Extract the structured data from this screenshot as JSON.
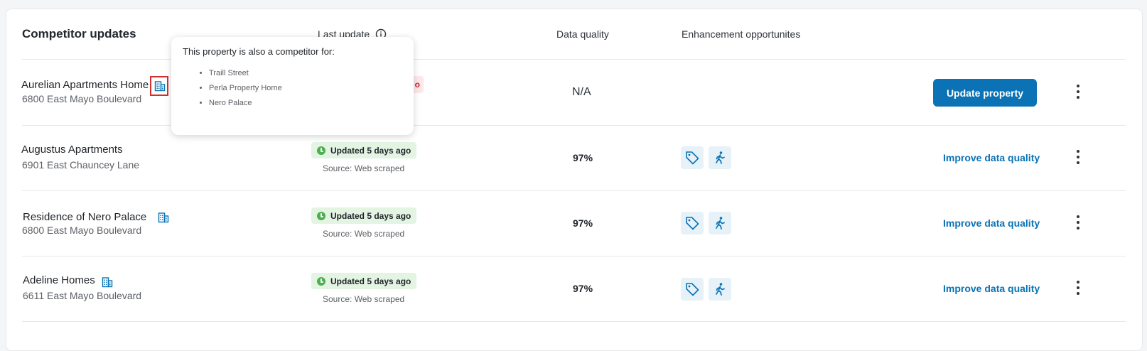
{
  "header": {
    "title": "Competitor updates",
    "col_last_update": "Last update",
    "col_data_quality": "Data quality",
    "col_enhancement": "Enhancement opportunites"
  },
  "rows": [
    {
      "name": "Aurelian Apartments Home",
      "address": "6800 East Mayo Boulevard",
      "quality": "N/A",
      "action": "Update property",
      "hidden_badge_fragment": "o"
    },
    {
      "name": "Augustus Apartments",
      "address": "6901 East Chauncey Lane",
      "badge": "Updated 5 days ago",
      "source": "Source: Web scraped",
      "quality": "97%",
      "action": "Improve data quality"
    },
    {
      "name": "Residence of Nero Palace",
      "address": "6800 East Mayo Boulevard",
      "badge": "Updated 5 days ago",
      "source": "Source: Web scraped",
      "quality": "97%",
      "action": "Improve data quality"
    },
    {
      "name": "Adeline Homes",
      "address": "6611 East Mayo Boulevard",
      "badge": "Updated 5 days ago",
      "source": "Source: Web scraped",
      "quality": "97%",
      "action": "Improve data quality"
    }
  ],
  "tooltip": {
    "heading": "This property is also a competitor for:",
    "items": [
      "Traill Street",
      "Perla Property Home",
      "Nero Palace"
    ]
  },
  "colors": {
    "accent": "#0a72b5",
    "badge_bg": "#e3f4e3",
    "badge_icon": "#4caf50",
    "highlight": "#d32f2f"
  },
  "icons": {
    "building": "building-icon",
    "info": "info-icon",
    "clock": "clock-icon",
    "tag": "tag-icon",
    "walk": "walking-person-icon",
    "more": "more-vertical-icon"
  }
}
